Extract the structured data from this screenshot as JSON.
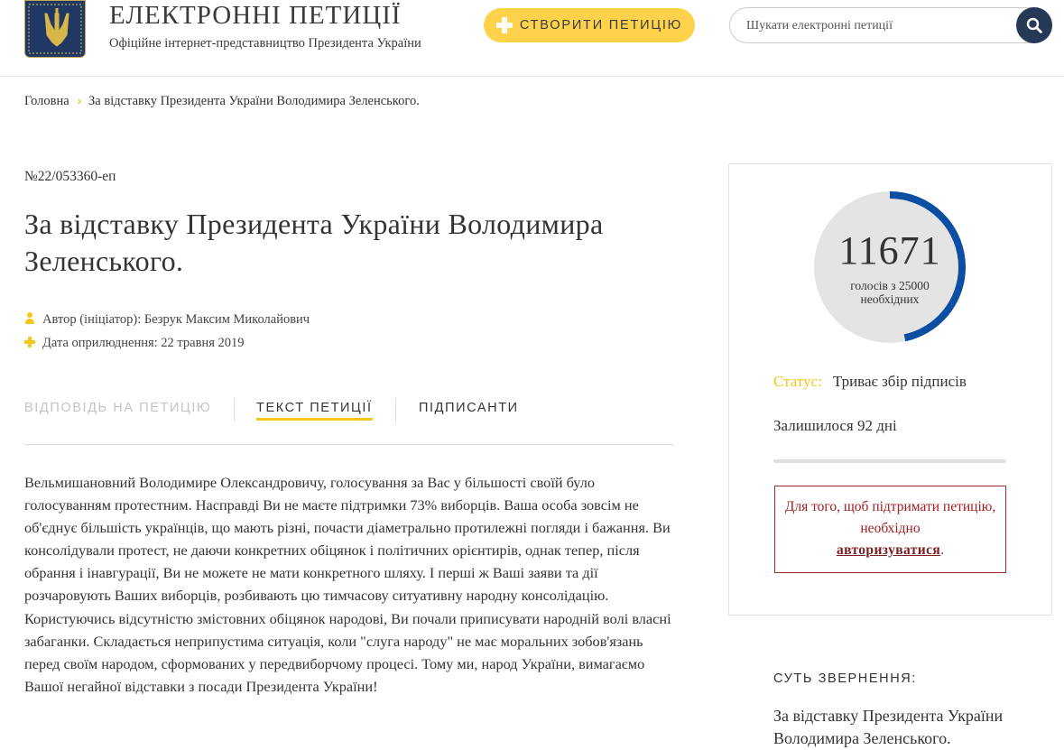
{
  "header": {
    "site_title": "ЕЛЕКТРОННІ ПЕТИЦІЇ",
    "site_subtitle": "Офіційне інтернет-представництво Президента України",
    "create_button": "СТВОРИТИ ПЕТИЦІЮ",
    "search_placeholder": "Шукати електронні петиції"
  },
  "breadcrumb": {
    "home": "Головна",
    "current": "За відставку Президента України Володимира Зеленського."
  },
  "petition": {
    "number": "№22/053360-еп",
    "title": "За відставку Президента України Володимира Зеленського.",
    "author": "Автор (ініціатор): Безрук Максим Миколайович",
    "published": "Дата оприлюднення: 22 травня 2019",
    "text": "Вельмишановний Володимире Олександровичу, голосування за Вас у більшості своїй було голосуванням протестним. Насправді Ви не маєте підтримки 73% виборців. Ваша особа зовсім не об'єднує більшість українців, що мають різні, почасти діаметрально протилежні погляди і бажання. Ви консолідували протест, не даючи конкретних обіцянок і політичних орієнтирів, однак тепер, після обрання і інавгурації, Ви не можете не мати конкретного шляху. І перші ж Ваші заяви та дії розчаровують Ваших виборців, розбивають цю тимчасову ситуативну народну консолідацію. Користуючись відсутністю змістовних обіцянок народові, Ви почали приписувати народній волі власні забаганки. Складається неприпустима ситуація, коли \"слуга народу\" не має моральних зобов'язань перед своїм народом, сформованих у передвиборчому процесі. Тому ми, народ України, вимагаємо Вашої негайної відставки з посади Президента України!"
  },
  "tabs": [
    {
      "label": "ВІДПОВІДЬ НА ПЕТИЦІЮ",
      "state": "disabled"
    },
    {
      "label": "ТЕКСТ ПЕТИЦІЇ",
      "state": "active"
    },
    {
      "label": "ПІДПИСАНТИ",
      "state": "normal"
    }
  ],
  "sidebar": {
    "votes": "11671",
    "votes_label": "голосів з 25000 необхідних",
    "votes_progress": 0.4668,
    "status_label": "Статус:",
    "status_value": "Триває збір підписів",
    "remaining": "Залишилося 92 дні",
    "auth_text_before": "Для того, щоб підтримати петицію, необхідно",
    "auth_link": "авторизуватися",
    "auth_text_after": ".",
    "essence_label": "СУТЬ ЗВЕРНЕННЯ:",
    "essence_text": "За відставку Президента України Володимира Зеленського."
  },
  "colors": {
    "accent_yellow": "#ffd24c",
    "progress_blue": "#0b4ea2",
    "progress_track": "#e4e4e4",
    "search_button": "#263956",
    "auth_red": "#a02020"
  },
  "icons": {
    "logo": "trident-coat-of-arms",
    "create": "plus-icon",
    "search": "search-icon",
    "author": "user-icon",
    "date": "plus-icon",
    "breadcrumb_separator": "chevron-right-icon"
  }
}
